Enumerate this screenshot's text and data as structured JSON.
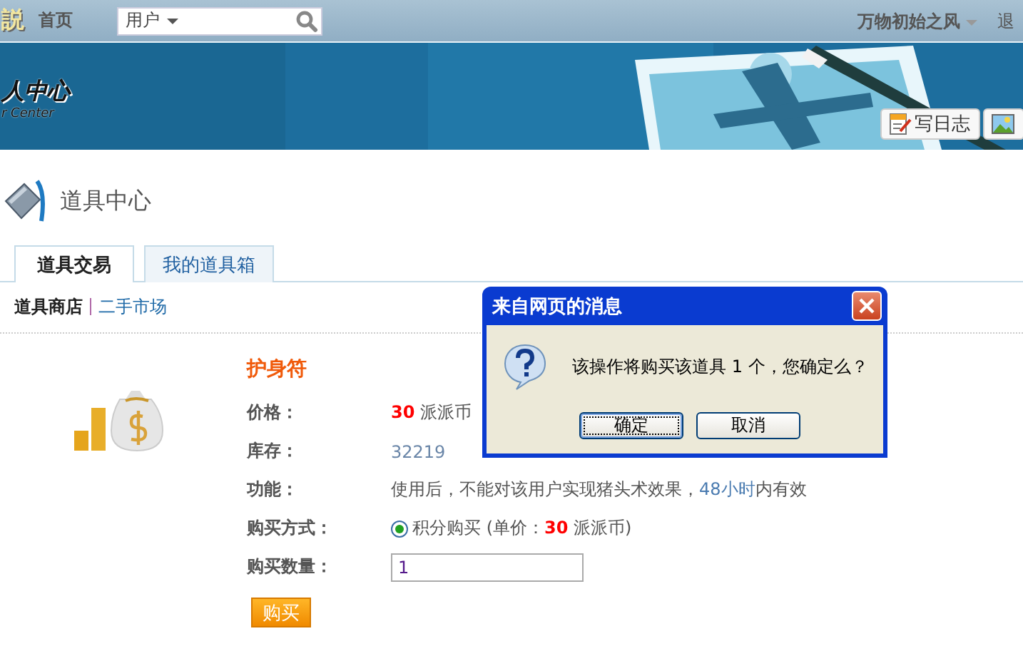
{
  "top_bar": {
    "logo": "説",
    "home": "首页",
    "search": {
      "scope": "用户"
    },
    "user": "万物初始之风",
    "logout": "退"
  },
  "banner": {
    "logo_title": "人中心",
    "logo_subtitle": "r Center",
    "buttons": [
      {
        "kind": "text",
        "label": "写日志"
      },
      {
        "kind": "icon"
      }
    ]
  },
  "page_title": "道具中心",
  "tabs": [
    {
      "label": "道具交易",
      "selected": true
    },
    {
      "label": "我的道具箱",
      "selected": false
    }
  ],
  "subnav": [
    {
      "label": "道具商店",
      "selected": true
    },
    {
      "label": "二手市场",
      "selected": false
    }
  ],
  "item": {
    "name": "护身符",
    "rows": [
      {
        "kind": "price",
        "label": "价格：",
        "amount": "30",
        "unit": "派派币"
      },
      {
        "kind": "stock",
        "label": "库存：",
        "value": "32219"
      },
      {
        "kind": "effect",
        "label": "功能：",
        "before": "使用后，不能对该用户实现猪头术效果，",
        "highlight": "48小时",
        "after": "内有效"
      },
      {
        "kind": "radio",
        "label": "购买方式：",
        "option": {
          "text": "积分购买 (单价：",
          "amount": "30",
          "unit": "派派币)",
          "selected": true
        }
      },
      {
        "kind": "input",
        "label": "购买数量：",
        "value": "1"
      }
    ],
    "buy_button": "购买"
  },
  "dialog": {
    "title": "来自网页的消息",
    "message": "该操作将购买该道具 1 个，您确定么？",
    "buttons": [
      {
        "label": "确定",
        "focused": true
      },
      {
        "label": "取消",
        "focused": false
      }
    ]
  }
}
